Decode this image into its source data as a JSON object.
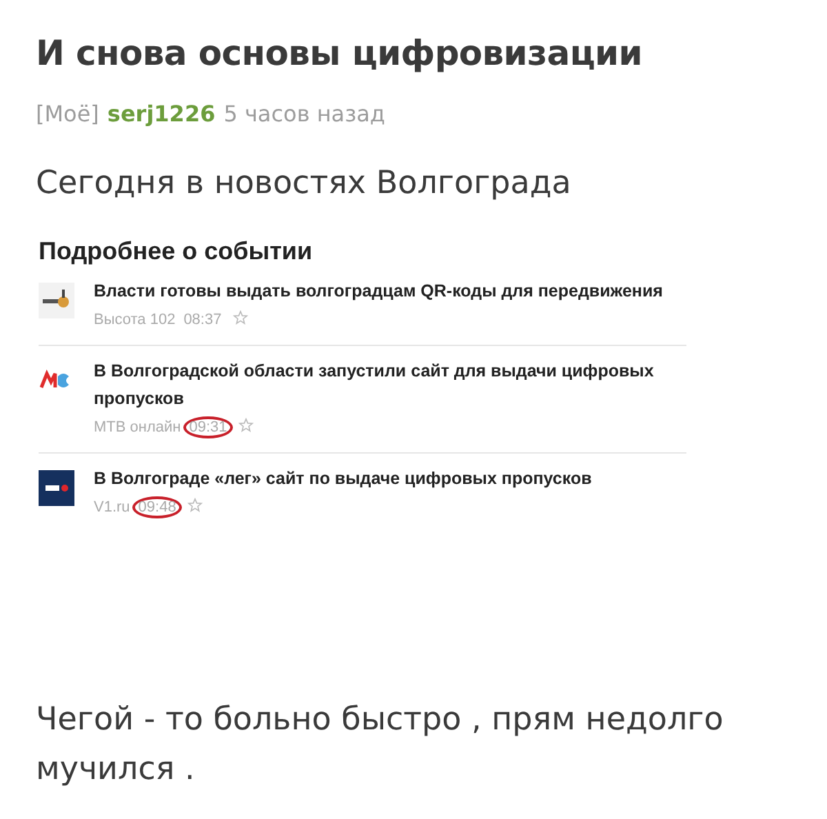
{
  "post": {
    "title": "И снова основы цифровизации",
    "tag": "[Моё]",
    "author": "serj1226",
    "time": "5 часов назад",
    "intro": "Сегодня в новостях Волгограда",
    "news": {
      "heading": "Подробнее о событии",
      "items": [
        {
          "kind": "tower",
          "headline": "Власти готовы выдать волгоградцам QR-коды для передвижения",
          "source": "Высота 102",
          "time": "08:37",
          "circled": false
        },
        {
          "kind": "waves",
          "headline": "В Волгоградской области запустили сайт для выдачи цифровых пропусков",
          "source": "МТВ онлайн",
          "time": "09:31",
          "circled": true
        },
        {
          "kind": "square",
          "headline": "В Волгограде «лег» сайт по выдаче цифровых пропусков",
          "source": "V1.ru",
          "time": "09:48",
          "circled": true
        }
      ]
    },
    "outro": "Чегой - то больно быстро , прям недолго мучился ."
  }
}
